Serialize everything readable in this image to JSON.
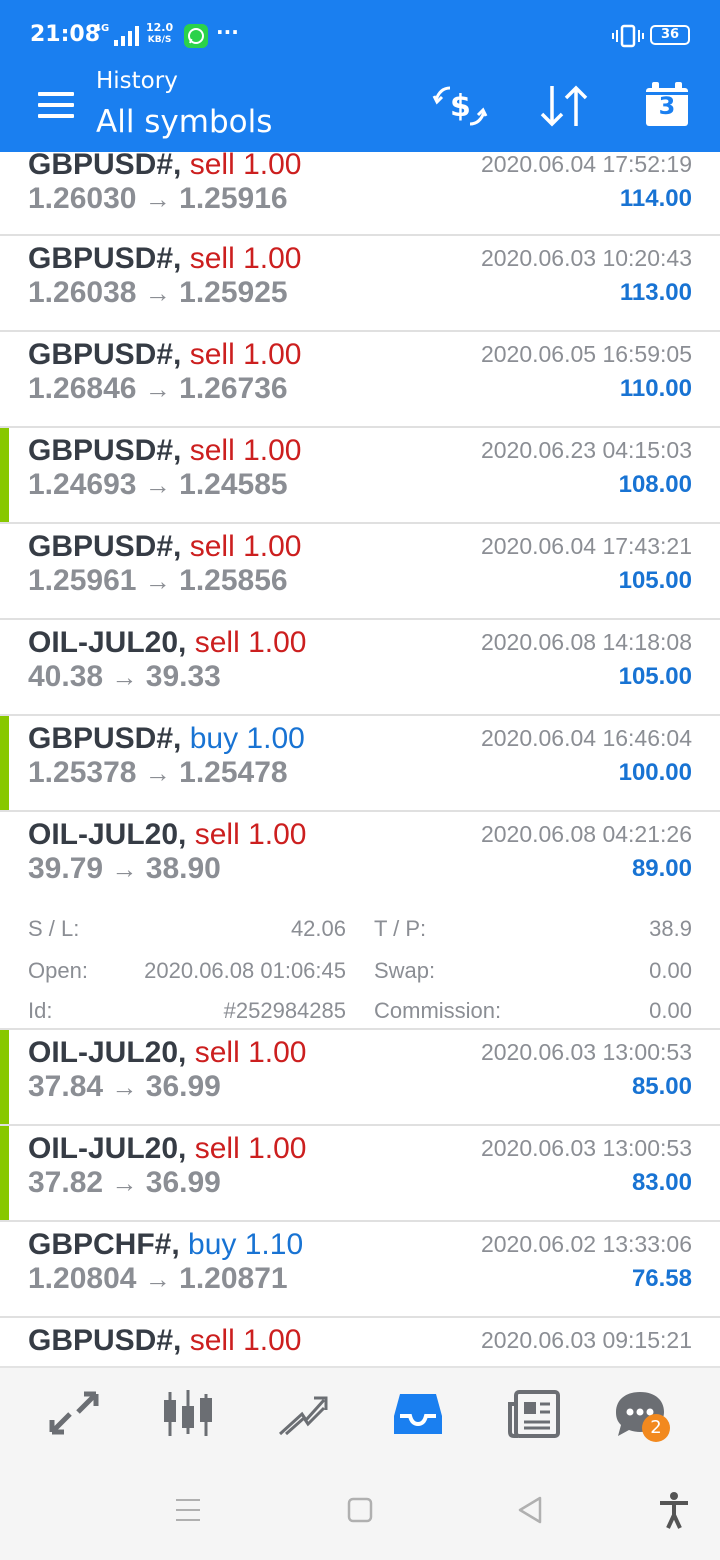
{
  "status_bar": {
    "time": "21:08",
    "network": "4G",
    "speed_value": "12.0",
    "speed_unit": "KB/S",
    "more": "···",
    "battery": "36"
  },
  "header": {
    "subtitle": "History",
    "title": "All symbols",
    "calendar_day": "3",
    "accent_color": "#1a7ff0"
  },
  "colors": {
    "sell": "#cc1f1f",
    "buy": "#1873d3",
    "marker": "#88c800",
    "badge": "#f2891e"
  },
  "trades": [
    {
      "symbol": "GBPUSD#,",
      "side": "sell",
      "action": "sell 1.00",
      "open_price": "1.26030",
      "close_price": "1.25916",
      "time": "2020.06.04 17:52:19",
      "profit": "114.00",
      "marked": false
    },
    {
      "symbol": "GBPUSD#,",
      "side": "sell",
      "action": "sell 1.00",
      "open_price": "1.26038",
      "close_price": "1.25925",
      "time": "2020.06.03 10:20:43",
      "profit": "113.00",
      "marked": false
    },
    {
      "symbol": "GBPUSD#,",
      "side": "sell",
      "action": "sell 1.00",
      "open_price": "1.26846",
      "close_price": "1.26736",
      "time": "2020.06.05 16:59:05",
      "profit": "110.00",
      "marked": false
    },
    {
      "symbol": "GBPUSD#,",
      "side": "sell",
      "action": "sell 1.00",
      "open_price": "1.24693",
      "close_price": "1.24585",
      "time": "2020.06.23 04:15:03",
      "profit": "108.00",
      "marked": true
    },
    {
      "symbol": "GBPUSD#,",
      "side": "sell",
      "action": "sell 1.00",
      "open_price": "1.25961",
      "close_price": "1.25856",
      "time": "2020.06.04 17:43:21",
      "profit": "105.00",
      "marked": false
    },
    {
      "symbol": "OIL-JUL20,",
      "side": "sell",
      "action": "sell 1.00",
      "open_price": "40.38",
      "close_price": "39.33",
      "time": "2020.06.08 14:18:08",
      "profit": "105.00",
      "marked": false
    },
    {
      "symbol": "GBPUSD#,",
      "side": "buy",
      "action": "buy 1.00",
      "open_price": "1.25378",
      "close_price": "1.25478",
      "time": "2020.06.04 16:46:04",
      "profit": "100.00",
      "marked": true
    },
    {
      "symbol": "OIL-JUL20,",
      "side": "sell",
      "action": "sell 1.00",
      "open_price": "39.79",
      "close_price": "38.90",
      "time": "2020.06.08 04:21:26",
      "profit": "89.00",
      "marked": false,
      "details": {
        "sl_label": "S / L:",
        "sl_value": "42.06",
        "tp_label": "T / P:",
        "tp_value": "38.9",
        "open_label": "Open:",
        "open_value": "2020.06.08 01:06:45",
        "swap_label": "Swap:",
        "swap_value": "0.00",
        "id_label": "Id:",
        "id_value": "#252984285",
        "commission_label": "Commission:",
        "commission_value": "0.00"
      }
    },
    {
      "symbol": "OIL-JUL20,",
      "side": "sell",
      "action": "sell 1.00",
      "open_price": "37.84",
      "close_price": "36.99",
      "time": "2020.06.03 13:00:53",
      "profit": "85.00",
      "marked": true
    },
    {
      "symbol": "OIL-JUL20,",
      "side": "sell",
      "action": "sell 1.00",
      "open_price": "37.82",
      "close_price": "36.99",
      "time": "2020.06.03 13:00:53",
      "profit": "83.00",
      "marked": true
    },
    {
      "symbol": "GBPCHF#,",
      "side": "buy",
      "action": "buy 1.10",
      "open_price": "1.20804",
      "close_price": "1.20871",
      "time": "2020.06.02 13:33:06",
      "profit": "76.58",
      "marked": false
    },
    {
      "symbol": "GBPUSD#,",
      "side": "sell",
      "action": "sell 1.00",
      "open_price": "",
      "close_price": "",
      "time": "2020.06.03 09:15:21",
      "profit": "",
      "marked": false
    }
  ],
  "arrow_glyph": "→",
  "bottom_nav": {
    "items": [
      "quotes-icon",
      "chart-icon",
      "trade-icon",
      "history-icon",
      "news-icon",
      "chat-icon"
    ],
    "active": "history-icon",
    "chat_badge": "2"
  }
}
